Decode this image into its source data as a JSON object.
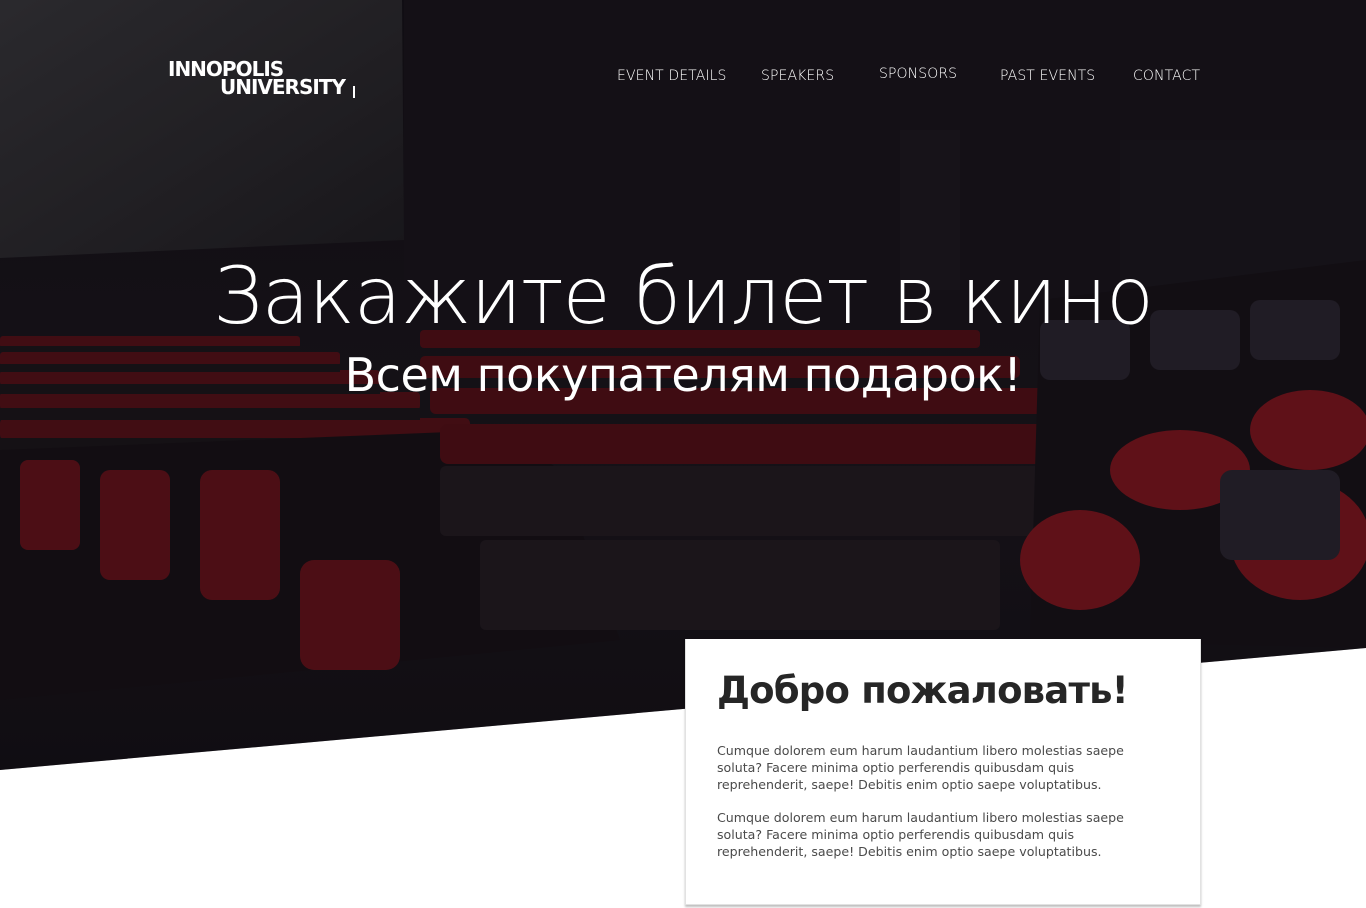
{
  "brand": {
    "line1": "INNOPOLIS",
    "line2": "UNIVERSITY",
    "logo_icon": "innopolis-wordmark"
  },
  "nav": {
    "items": [
      {
        "label": "EVENT DETAILS"
      },
      {
        "label": "SPEAKERS"
      },
      {
        "label": "SPONSORS"
      },
      {
        "label": "PAST EVENTS"
      },
      {
        "label": "CONTACT"
      }
    ]
  },
  "hero": {
    "title": "Закажите билет в кино",
    "subtitle": "Всем покупателям подарок!",
    "background": "cinema-hall-photo"
  },
  "welcome": {
    "title": "Добро пожаловать!",
    "paragraphs": [
      "Cumque dolorem eum harum laudantium libero molestias saepe soluta? Facere minima optio perferendis quibusdam quis reprehenderit, saepe! Debitis enim optio saepe voluptatibus.",
      "Cumque dolorem eum harum laudantium libero molestias saepe soluta? Facere minima optio perferendis quibusdam quis reprehenderit, saepe! Debitis enim optio saepe voluptatibus."
    ]
  },
  "colors": {
    "hero_dark": "#17131a",
    "seat_red": "#7a1219",
    "text_white": "#ffffff",
    "card_title": "#262626",
    "card_text": "#4a4a4a"
  }
}
